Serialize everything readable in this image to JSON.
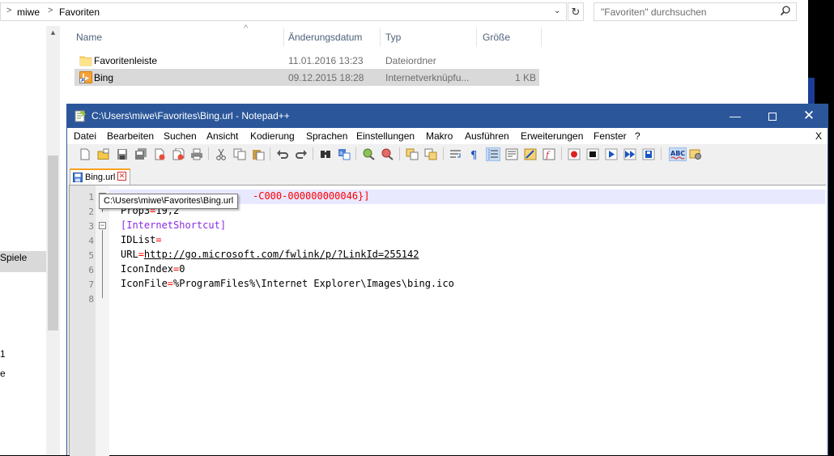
{
  "explorer": {
    "breadcrumb": [
      "miwe",
      "Favoriten"
    ],
    "search_placeholder": "\"Favoriten\" durchsuchen",
    "columns": {
      "name": "Name",
      "date": "Änderungsdatum",
      "type": "Typ",
      "size": "Größe"
    },
    "files": [
      {
        "name": "Favoritenleiste",
        "date": "11.01.2016 13:23",
        "type": "Dateiordner",
        "size": "",
        "icon": "folder-icon"
      },
      {
        "name": "Bing",
        "date": "09.12.2015 18:28",
        "type": "Internetverknüpfu...",
        "size": "1 KB",
        "icon": "bing-url-icon"
      }
    ],
    "nav_fragments": [
      "Spiele",
      "1",
      "e"
    ]
  },
  "notepad": {
    "title": "C:\\Users\\miwe\\Favorites\\Bing.url - Notepad++",
    "menu": [
      "Datei",
      "Bearbeiten",
      "Suchen",
      "Ansicht",
      "Kodierung",
      "Sprachen",
      "Einstellungen",
      "Makro",
      "Ausführen",
      "Erweiterungen",
      "Fenster",
      "?"
    ],
    "menu_close": "X",
    "tab_label": "Bing.url",
    "tooltip": "C:\\Users\\miwe\\Favorites\\Bing.url",
    "line_numbers": [
      "1",
      "2",
      "3",
      "4",
      "5",
      "6",
      "7",
      "8"
    ],
    "lines": {
      "l1_visible": "-C000-000000000046}]",
      "l2_key": "Prop3",
      "l2_val": "19,2",
      "l3": "[InternetShortcut]",
      "l4_key": "IDList",
      "l5_key": "URL",
      "l5_url": "http://go.microsoft.com/fwlink/p/?LinkId=255142",
      "l6_key": "IconIndex",
      "l6_val": "0",
      "l7_key": "IconFile",
      "l7_val": "%ProgramFiles%\\Internet Explorer\\Images\\bing.ico"
    },
    "colors": {
      "titlebar": "#2b579a",
      "current_line": "#e8e8ff",
      "section": "#8a2be2",
      "operator": "#ff0000"
    }
  }
}
